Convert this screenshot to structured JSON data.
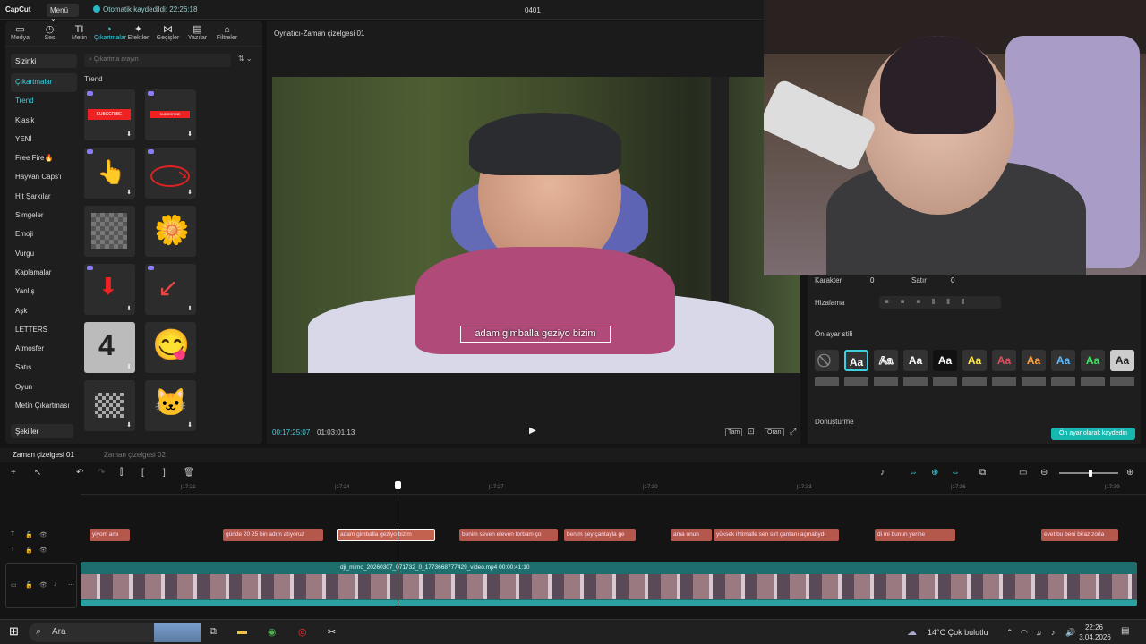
{
  "app": {
    "logo": "CapCut",
    "menu": "Menü",
    "saved": "Otomatik kaydedildi: 22:26:18",
    "project": "0401"
  },
  "tabs": [
    {
      "icon": "▭",
      "label": "Medya"
    },
    {
      "icon": "◷",
      "label": "Ses"
    },
    {
      "icon": "TI",
      "label": "Metin"
    },
    {
      "icon": "◔",
      "label": "Çıkartmalar"
    },
    {
      "icon": "✦",
      "label": "Efektler"
    },
    {
      "icon": "⋈",
      "label": "Geçişler"
    },
    {
      "icon": "▤",
      "label": "Yazılar"
    },
    {
      "icon": "⌂",
      "label": "Filtreler"
    }
  ],
  "categories": {
    "dropdown": "Sizinki",
    "section": "Çıkartmalar",
    "items": [
      "Trend",
      "Klasik",
      "YENİ",
      "Free Fire🔥",
      "Hayvan Caps'i",
      "Hit Şarkılar",
      "Simgeler",
      "Emoji",
      "Vurgu",
      "Kaplamalar",
      "Yanlış",
      "Aşk",
      "LETTERS",
      "Atmosfer",
      "Satış",
      "Oyun",
      "Metin Çıkartması"
    ],
    "bottom": "Şekiller"
  },
  "search": {
    "placeholder": "Çıkartma arayın",
    "filter": "⇅ ⌄"
  },
  "trend_label": "Trend",
  "stickers": [
    "SUBSCRIBE",
    "SUBSCRIBE",
    "👆",
    "➘",
    "▦",
    "🌼",
    "⬇",
    "↙",
    "4",
    "😋",
    "▦",
    "🐱"
  ],
  "player": {
    "title": "Oynatıcı-Zaman çizelgesi 01",
    "caption": "adam gimballa geziyo bizim",
    "current": "00:17:25:07",
    "duration": "01:03:01:13",
    "btn_full": "Tam",
    "btn_ratio": "Oran",
    "play": "▶"
  },
  "props": {
    "char_label": "Karakter",
    "char_val": "0",
    "line_label": "Satır",
    "line_val": "0",
    "align_label": "Hizalama",
    "preset_label": "Ön ayar stili",
    "transform_label": "Dönüştürme",
    "save_preset": "Ön ayar olarak kaydedin",
    "swatches": [
      "⃠",
      "Aa",
      "Aa",
      "Aa",
      "Aa",
      "Aa",
      "Aa",
      "Aa",
      "Aa",
      "Aa",
      "Aa"
    ],
    "swatch_colors": [
      "#888",
      "#fff",
      "#fff",
      "#fff",
      "#ffe84a",
      "#e84a5a",
      "#ffa040",
      "#5ab8ff",
      "#40e060",
      "#fff",
      "#fff"
    ]
  },
  "timeline": {
    "tab1": "Zaman çizelgesi 01",
    "tab2": "Zaman çizelgesi 02",
    "ticks": [
      "|17:21",
      "|17:24",
      "|17:27",
      "|17:30",
      "|17:33",
      "|17:36",
      "|17:39"
    ],
    "text_clips": [
      "yiyom amı",
      "günde 20 25 bin adım atıyoruz",
      "adam gimballa geziyo bizim",
      "benim seven eleven torbam ço",
      "benim şey çantayla ge",
      "ama onun",
      "yüksek ihtimalle sen sırt çantanı açmabydı",
      "di mi bunun yerine",
      "evet bu beni biraz zorla"
    ],
    "video_clip": "dji_mimo_20260307_071732_0_1773668777429_video.mp4   00:00:41:10"
  },
  "taskbar": {
    "search": "Ara",
    "weather": "14°C  Çok bulutlu",
    "time": "22:26",
    "date": "3.04.2026"
  }
}
